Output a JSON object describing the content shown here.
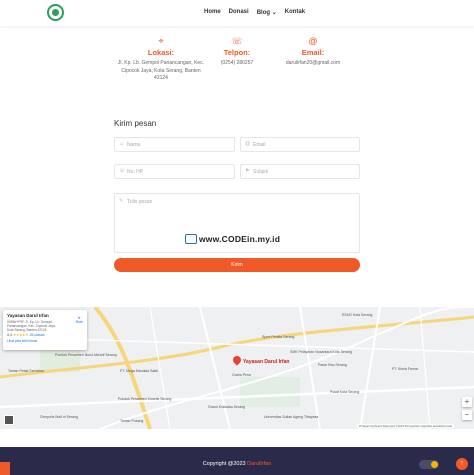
{
  "nav": {
    "items": [
      {
        "label": "Home"
      },
      {
        "label": "Donasi"
      },
      {
        "label": "Blog",
        "caret": "⌄"
      },
      {
        "label": "Kontak"
      }
    ]
  },
  "contact": {
    "lokasi": {
      "icon": "location-pin-icon",
      "glyph": "⌖",
      "title": "Lokasi:",
      "text": "Jl. Kp. Lb. Gempol Panancangan, Kec. Cipocok Jaya, Kota Serang, Banten 42124"
    },
    "telpon": {
      "icon": "phone-icon",
      "glyph": "☏",
      "title": "Telpon:",
      "text": "(0254) 280257"
    },
    "email": {
      "icon": "at-icon",
      "glyph": "@",
      "title": "Email:",
      "text": "darulirfan20@gmail.com"
    }
  },
  "form": {
    "title": "Kirim pesan",
    "nama_placeholder": "Nama",
    "email_placeholder": "Email",
    "hp_placeholder": "No. HP",
    "subjek_placeholder": "Subjek",
    "pesan_placeholder": "Tulis pesan",
    "submit_label": "Kirim",
    "watermark": "www.CODEin.my.id"
  },
  "map": {
    "card": {
      "title": "Yayasan Darul Irfan",
      "address": "V5MW+P9F, Jl. Kp. Lb. Gempol, Panancangan, Kec. Cipocok Jaya, Kota Serang, Banten 42124",
      "rating": "4.4",
      "stars": "★★★★★",
      "reviews": "26 ulasan",
      "larger_map": "Lihat peta lebih besar",
      "directions": "Rute"
    },
    "pin_label": "Yayasan Darul Irfan",
    "labels": [
      {
        "text": "Pondok Pesantren Nurul Ma'arif Serang"
      },
      {
        "text": "Taman Petak Sembilan"
      },
      {
        "text": "PT. Mega Mandala Sakti"
      },
      {
        "text": "Pondok Pesantren Kwartis Serang"
      },
      {
        "text": "Cinepolis Mall of Serang"
      },
      {
        "text": "Taman Pusang"
      },
      {
        "text": "SMK Pelayaran Nusantara Kota Serang"
      },
      {
        "text": "Graha Pena"
      },
      {
        "text": "Grand Krakatau Serang"
      },
      {
        "text": "Universitas Sultan Ageng Tirtayasa"
      },
      {
        "text": "Pusat Kota Serang"
      },
      {
        "text": "RSUD Kota Serang"
      },
      {
        "text": "Sport Persita Serang"
      },
      {
        "text": "PT. Kimia Farma"
      },
      {
        "text": "Pasar Rau Serang"
      }
    ],
    "zoom_in": "+",
    "zoom_out": "−",
    "attribution": "Pintasan keyboard  Data peta ©2023  Persyaratan  Laporkan kesalahan peta"
  },
  "footer": {
    "copyright_prefix": "Copyright @2023 ",
    "brand": "DarulIrfan",
    "back_to_top": "↑"
  },
  "colors": {
    "accent": "#f05a28",
    "footer_bg": "#2a2a4a",
    "logo_green": "#2e9d5b"
  }
}
